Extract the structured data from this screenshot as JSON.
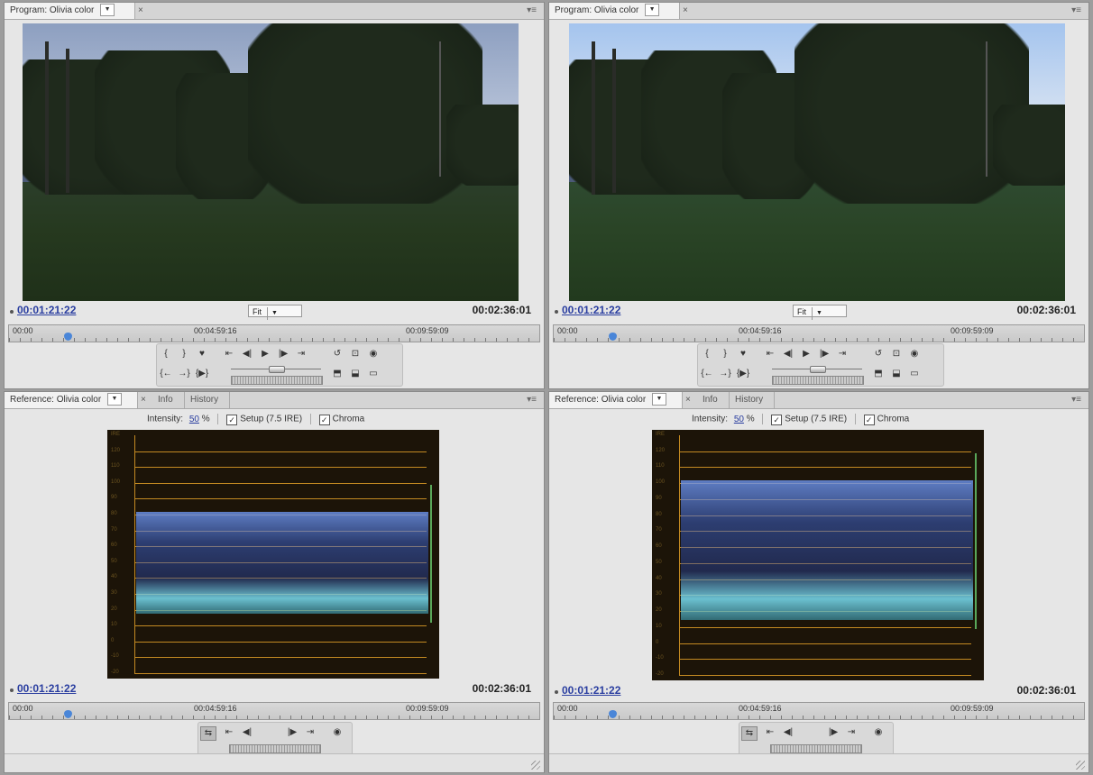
{
  "panels": {
    "top_left": {
      "tab": "Program: Olivia color",
      "fit": "Fit",
      "current_time": "00:01:21:22",
      "duration": "00:02:36:01",
      "ruler": [
        "00:00",
        "00:04:59:16",
        "00:09:59:09"
      ]
    },
    "top_right": {
      "tab": "Program: Olivia color",
      "fit": "Fit",
      "current_time": "00:01:21:22",
      "duration": "00:02:36:01",
      "ruler": [
        "00:00",
        "00:04:59:16",
        "00:09:59:09"
      ]
    },
    "bottom_left": {
      "tab": "Reference: Olivia color",
      "tab_info": "Info",
      "tab_history": "History",
      "intensity_label": "Intensity:",
      "intensity_value": "50",
      "intensity_unit": "%",
      "setup_label": "Setup (7.5 IRE)",
      "setup_checked": true,
      "chroma_label": "Chroma",
      "chroma_checked": true,
      "current_time": "00:01:21:22",
      "duration": "00:02:36:01",
      "ruler": [
        "00:00",
        "00:04:59:16",
        "00:09:59:09"
      ]
    },
    "bottom_right": {
      "tab": "Reference: Olivia color",
      "tab_info": "Info",
      "tab_history": "History",
      "intensity_label": "Intensity:",
      "intensity_value": "50",
      "intensity_unit": "%",
      "setup_label": "Setup (7.5 IRE)",
      "setup_checked": true,
      "chroma_label": "Chroma",
      "chroma_checked": true,
      "current_time": "00:01:21:22",
      "duration": "00:02:36:01",
      "ruler": [
        "00:00",
        "00:04:59:16",
        "00:09:59:09"
      ]
    }
  },
  "scope": {
    "scale_labels": [
      "IRE",
      "120",
      "110",
      "100",
      "90",
      "80",
      "70",
      "60",
      "50",
      "40",
      "30",
      "20",
      "10",
      "0",
      "-10",
      "-20"
    ],
    "trace_color": "#4f7fe0",
    "graticule_color": "#c48a22"
  },
  "icons": {
    "mark_in": "{",
    "mark_out": "}",
    "marker": "♥",
    "goto_in": "{←",
    "goto_out": "→}",
    "step_back": "◀|",
    "play": "▶",
    "step_fwd": "|▶",
    "play_in_out": "{▶}",
    "go_prev_edit": "⇤",
    "go_next_edit": "⇥",
    "loop": "↺",
    "safe_margins": "⊡",
    "output": "◉",
    "lift": "⬒",
    "extract": "⬓",
    "trim": "▭",
    "gang": "⇆",
    "menu": "▾≡",
    "close": "×",
    "dropdown": "▼"
  }
}
